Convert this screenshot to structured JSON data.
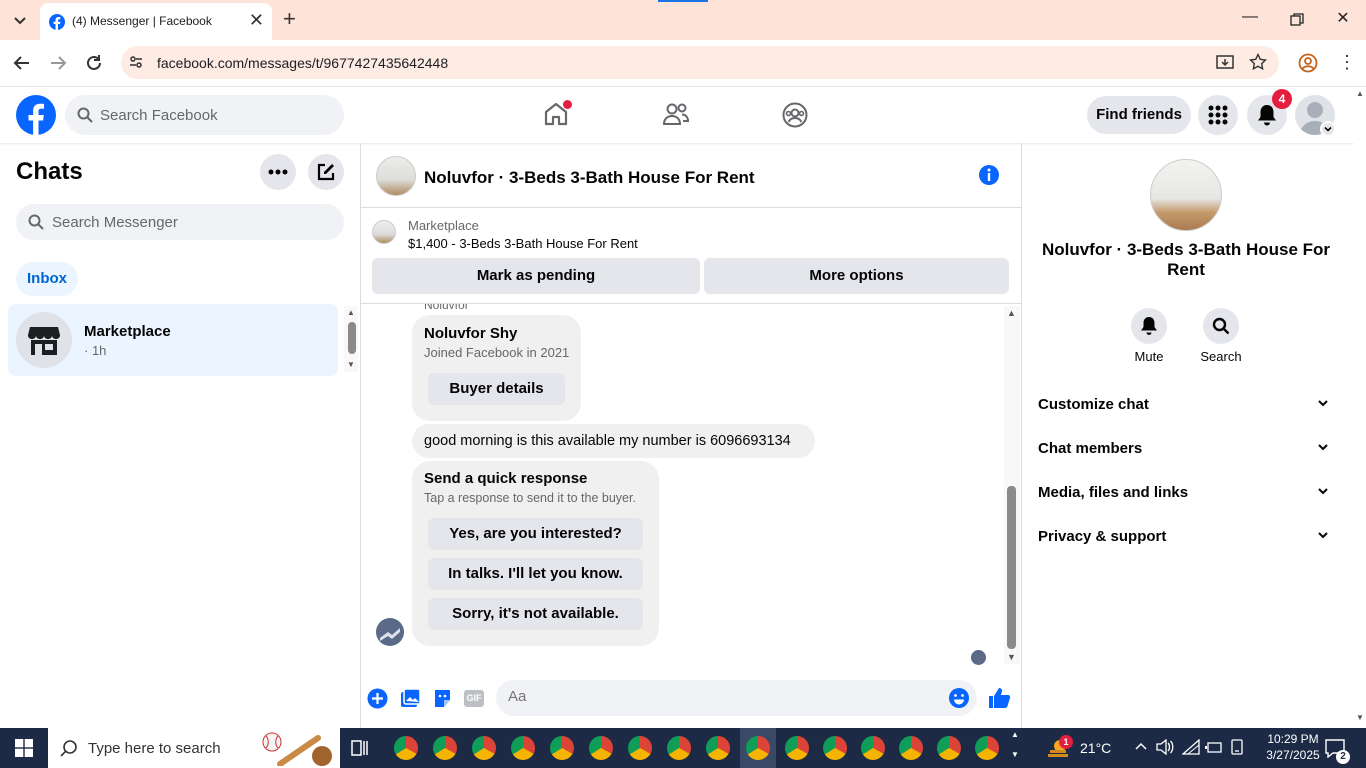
{
  "browser": {
    "tab_title": "(4) Messenger | Facebook",
    "url": "facebook.com/messages/t/9677427435642448",
    "new_tab": "+"
  },
  "fb": {
    "search_placeholder": "Search Facebook",
    "find_friends": "Find friends",
    "notif_count": "4",
    "brand_color": "#0866ff"
  },
  "sidebar": {
    "title": "Chats",
    "search_placeholder": "Search Messenger",
    "filter": "Inbox",
    "chats": [
      {
        "name": "Marketplace",
        "time": "· 1h"
      }
    ]
  },
  "conversation": {
    "title": "Noluvfor · 3-Beds 3-Bath House For Rent",
    "marketplace_label": "Marketplace",
    "listing": "$1,400 - 3-Beds 3-Bath House For Rent",
    "mark_pending": "Mark as pending",
    "more_options": "More options",
    "sender_tag": "Noluvfor",
    "buyer_card": {
      "name": "Noluvfor Shy",
      "joined": "Joined Facebook in 2021",
      "button": "Buyer details"
    },
    "message": "good morning is this available my number is 6096693134",
    "quick_response": {
      "title": "Send a quick response",
      "subtitle": "Tap a response to send it to the buyer.",
      "options": [
        "Yes, are you interested?",
        "In talks. I'll let you know.",
        "Sorry, it's not available."
      ]
    },
    "composer_placeholder": "Aa"
  },
  "details": {
    "title": "Noluvfor · 3-Beds 3-Bath House For Rent",
    "mute": "Mute",
    "search": "Search",
    "sections": [
      "Customize chat",
      "Chat members",
      "Media, files and links",
      "Privacy & support"
    ]
  },
  "taskbar": {
    "search_placeholder": "Type here to search",
    "temperature": "21°C",
    "time": "10:29 PM",
    "date": "3/27/2025",
    "notif_count": "2",
    "weather_badge": "1"
  }
}
